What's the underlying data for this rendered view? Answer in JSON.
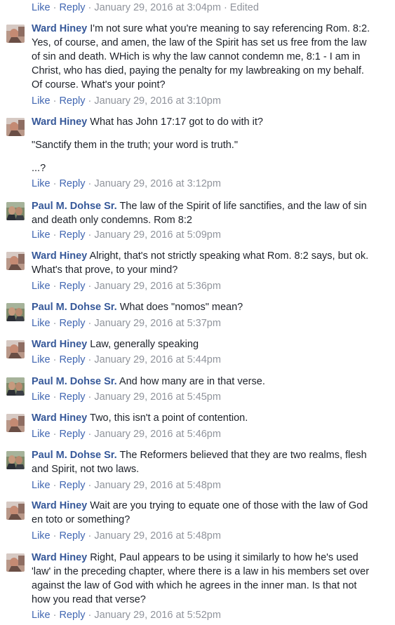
{
  "actions": {
    "like": "Like",
    "reply": "Reply",
    "separator": "·",
    "edited": "Edited"
  },
  "first_row_time": "January 29, 2016 at 3:04pm",
  "comments": [
    {
      "author": "Ward Hiney",
      "avatar": "ward-avatar",
      "paragraphs": [
        "I'm not sure what you're meaning to say referencing Rom. 8:2. Yes, of course, and amen, the law of the Spirit has set us free from the law of sin and death. WHich is why the law cannot condemn me, 8:1 - I am in Christ, who has died, paying the penalty for my lawbreaking on my behalf. Of course. What's your point?"
      ],
      "time": "January 29, 2016 at 3:10pm"
    },
    {
      "author": "Ward Hiney",
      "avatar": "ward-avatar",
      "paragraphs": [
        "What has John 17:17 got to do with it?",
        "\"Sanctify them in the truth; your word is truth.\"",
        "...?"
      ],
      "time": "January 29, 2016 at 3:12pm"
    },
    {
      "author": "Paul M. Dohse Sr.",
      "avatar": "paul-avatar",
      "paragraphs": [
        "The law of the Spirit of life sanctifies, and the law of sin and death only condemns. Rom 8:2"
      ],
      "time": "January 29, 2016 at 5:09pm"
    },
    {
      "author": "Ward Hiney",
      "avatar": "ward-avatar",
      "paragraphs": [
        "Alright, that's not strictly speaking what Rom. 8:2 says, but ok. What's that prove, to your mind?"
      ],
      "time": "January 29, 2016 at 5:36pm"
    },
    {
      "author": "Paul M. Dohse Sr.",
      "avatar": "paul-avatar",
      "paragraphs": [
        "What does \"nomos\" mean?"
      ],
      "time": "January 29, 2016 at 5:37pm"
    },
    {
      "author": "Ward Hiney",
      "avatar": "ward-avatar",
      "paragraphs": [
        "Law, generally speaking"
      ],
      "time": "January 29, 2016 at 5:44pm"
    },
    {
      "author": "Paul M. Dohse Sr.",
      "avatar": "paul-avatar",
      "paragraphs": [
        "And how many are in that verse."
      ],
      "time": "January 29, 2016 at 5:45pm"
    },
    {
      "author": "Ward Hiney",
      "avatar": "ward-avatar",
      "paragraphs": [
        "Two, this isn't a point of contention."
      ],
      "time": "January 29, 2016 at 5:46pm"
    },
    {
      "author": "Paul M. Dohse Sr.",
      "avatar": "paul-avatar",
      "paragraphs": [
        "The Reformers believed that they are two realms, flesh and Spirit, not two laws."
      ],
      "time": "January 29, 2016 at 5:48pm"
    },
    {
      "author": "Ward Hiney",
      "avatar": "ward-avatar",
      "paragraphs": [
        "Wait are you trying to equate one of those with the law of God en toto or something?"
      ],
      "time": "January 29, 2016 at 5:48pm"
    },
    {
      "author": "Ward Hiney",
      "avatar": "ward-avatar",
      "paragraphs": [
        "Right, Paul appears to be using it similarly to how he's used 'law' in the preceding chapter, where there is a law in his members set over against the law of God with which he agrees in the inner man. Is that not how you read that verse?"
      ],
      "time": "January 29, 2016 at 5:52pm"
    }
  ]
}
